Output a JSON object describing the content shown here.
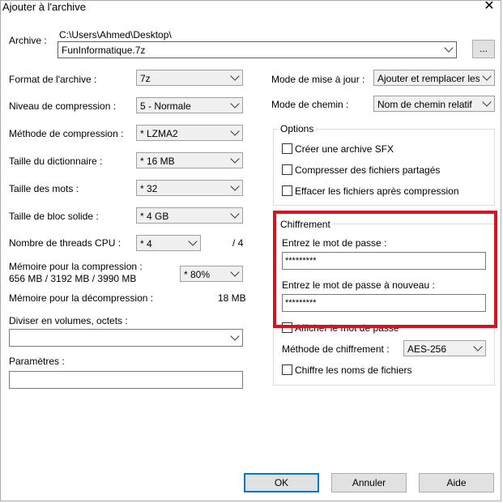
{
  "window": {
    "title": "Ajouter à l'archive",
    "close_glyph": "✕"
  },
  "archive": {
    "label": "Archive :",
    "path": "C:\\Users\\Ahmed\\Desktop\\",
    "filename": "FunInformatique.7z",
    "browse_label": "..."
  },
  "left": {
    "format": {
      "label": "Format de l'archive :",
      "value": "7z"
    },
    "level": {
      "label": "Niveau de compression :",
      "value": "5 - Normale"
    },
    "method": {
      "label": "Méthode de compression :",
      "value": "*  LZMA2"
    },
    "dict": {
      "label": "Taille du dictionnaire :",
      "value": "*  16 MB"
    },
    "word": {
      "label": "Taille des mots :",
      "value": "*  32"
    },
    "solid": {
      "label": "Taille de bloc solide :",
      "value": "*  4 GB"
    },
    "threads": {
      "label": "Nombre de threads CPU :",
      "value": "*  4",
      "max": "/ 4"
    },
    "mem_comp": {
      "label": "Mémoire pour la compression :",
      "detail": "656 MB / 3192 MB / 3990 MB",
      "value": "* 80%"
    },
    "mem_decomp": {
      "label": "Mémoire pour la décompression :",
      "value": "18 MB"
    },
    "split": {
      "label": "Diviser en volumes, octets :",
      "value": ""
    },
    "params": {
      "label": "Paramètres :",
      "value": ""
    }
  },
  "right": {
    "update_mode": {
      "label": "Mode de mise à jour :",
      "value": "Ajouter et remplacer les fichiers"
    },
    "path_mode": {
      "label": "Mode de chemin :",
      "value": "Nom de chemin relatif"
    },
    "options": {
      "title": "Options",
      "sfx": "Créer une archive SFX",
      "shared": "Compresser des fichiers partagés",
      "delete": "Effacer les fichiers après compression"
    },
    "encryption": {
      "title": "Chiffrement",
      "pwd_label": "Entrez le mot de passe :",
      "pwd_value": "*********",
      "pwd2_label": "Entrez le mot de passe à nouveau :",
      "pwd2_value": "*********",
      "show_pwd": "Afficher le mot de passe",
      "method_label": "Méthode de chiffrement :",
      "method_value": "AES-256",
      "encrypt_names": "Chiffre les noms de fichiers"
    }
  },
  "buttons": {
    "ok": "OK",
    "cancel": "Annuler",
    "help": "Aide"
  },
  "colors": {
    "highlight": "#d9121f",
    "default_button_border": "#0078d7"
  }
}
